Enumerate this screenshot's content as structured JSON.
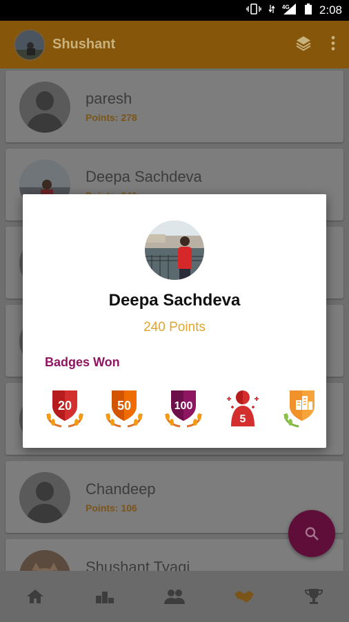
{
  "status_bar": {
    "time": "2:08",
    "network": "4G"
  },
  "app_bar": {
    "title": "Shushant",
    "icons": [
      "layers-icon",
      "more-vert-icon"
    ]
  },
  "list": {
    "items": [
      {
        "name": "paresh",
        "points": "Points: 278"
      },
      {
        "name": "Deepa Sachdeva",
        "points": "Points: 240"
      },
      {
        "name": "",
        "points": ""
      },
      {
        "name": "",
        "points": ""
      },
      {
        "name": "",
        "points": ""
      },
      {
        "name": "Chandeep",
        "points": "Points: 106"
      },
      {
        "name": "Shushant Tyagi",
        "points": ""
      }
    ]
  },
  "dialog": {
    "name": "Deepa Sachdeva",
    "points": "240 Points",
    "badges_title": "Badges Won",
    "badges": [
      {
        "label": "20",
        "color": "#d32f2f"
      },
      {
        "label": "50",
        "color": "#ef6c00"
      },
      {
        "label": "100",
        "color": "#8e1560"
      },
      {
        "label": "5",
        "color": "#d32f2f"
      },
      {
        "label": "",
        "color": "#f6a43a"
      }
    ]
  },
  "bottom_nav": {
    "items": [
      "home-icon",
      "leaderboard-icon",
      "people-icon",
      "handshake-icon",
      "trophy-icon"
    ],
    "active_index": 3
  },
  "colors": {
    "accent": "#f39c12",
    "primary_dark": "#8e1560",
    "points": "#e0a52e"
  }
}
